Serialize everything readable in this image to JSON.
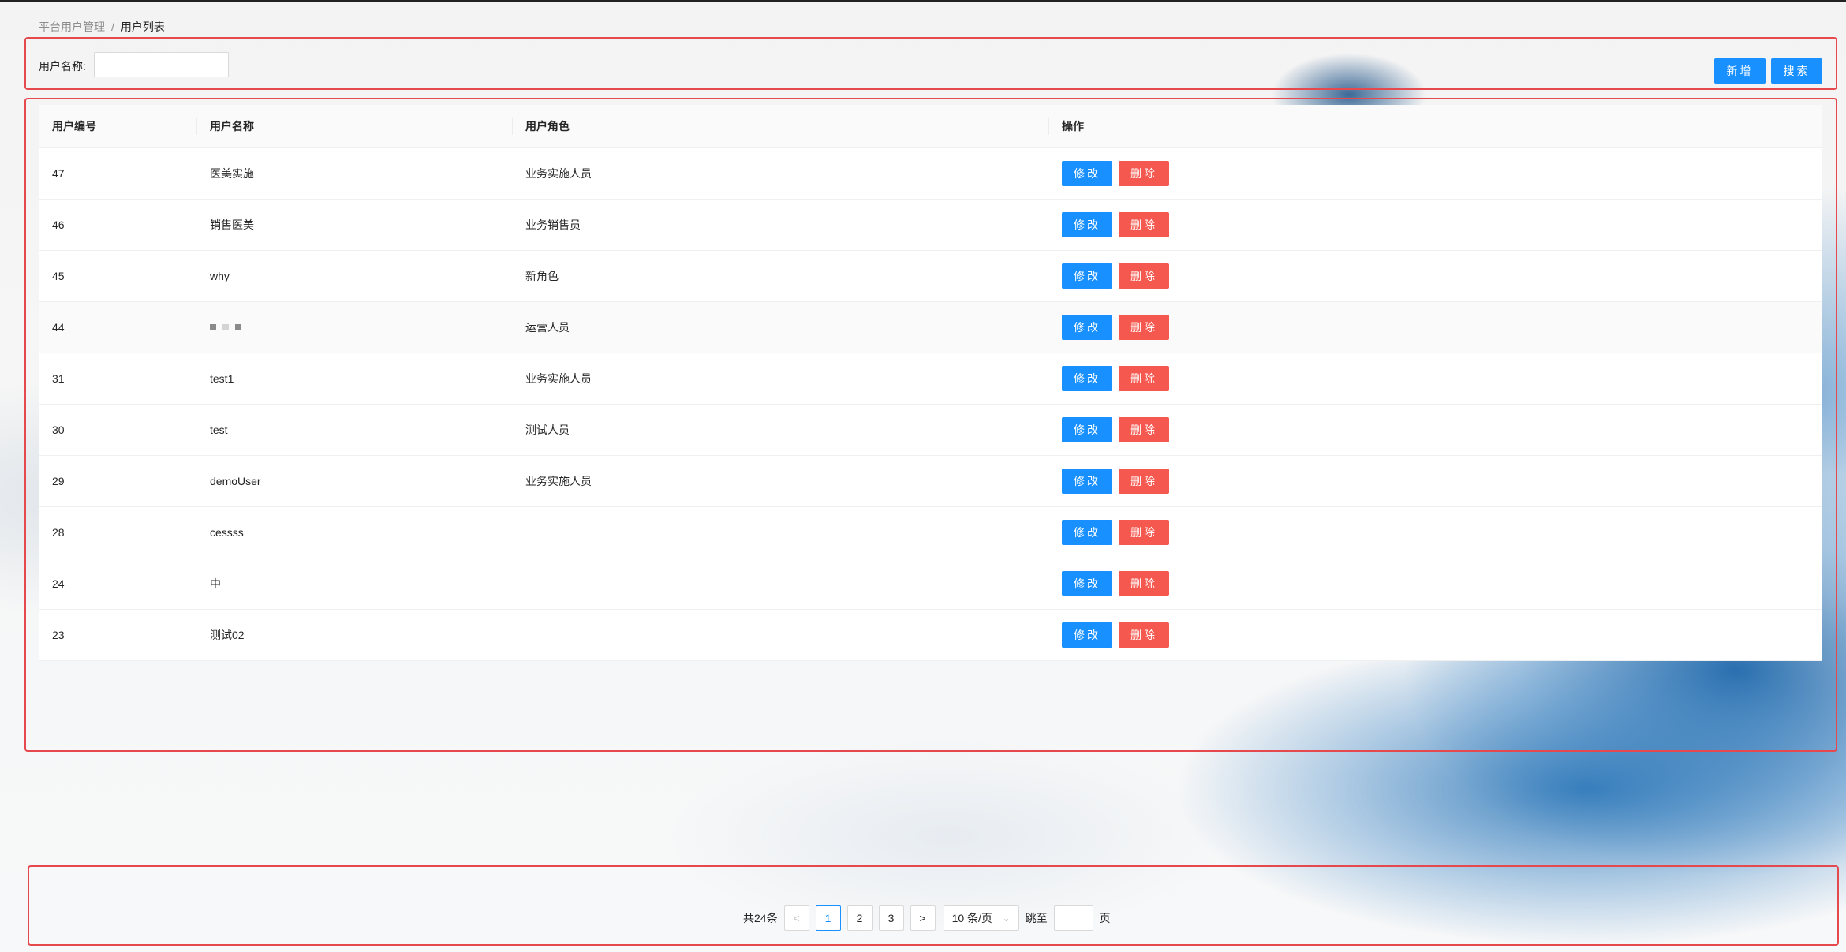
{
  "breadcrumb": {
    "parent": "平台用户管理",
    "separator": "/",
    "current": "用户列表"
  },
  "search": {
    "label": "用户名称:",
    "value": "",
    "placeholder": "",
    "add_label": "新增",
    "search_label": "搜索"
  },
  "table": {
    "headers": [
      "用户编号",
      "用户名称",
      "用户角色",
      "操作"
    ],
    "edit_label": "修改",
    "delete_label": "删除",
    "rows": [
      {
        "id": "47",
        "name": "医美实施",
        "role": "业务实施人员"
      },
      {
        "id": "46",
        "name": "销售医美",
        "role": "业务销售员"
      },
      {
        "id": "45",
        "name": "why",
        "role": "新角色"
      },
      {
        "id": "44",
        "name": "",
        "role": "运营人员"
      },
      {
        "id": "31",
        "name": "test1",
        "role": "业务实施人员"
      },
      {
        "id": "30",
        "name": "test",
        "role": "测试人员"
      },
      {
        "id": "29",
        "name": "demoUser",
        "role": "业务实施人员"
      },
      {
        "id": "28",
        "name": "cessss",
        "role": ""
      },
      {
        "id": "24",
        "name": "中",
        "role": ""
      },
      {
        "id": "23",
        "name": "测试02",
        "role": ""
      }
    ]
  },
  "pagination": {
    "total": "共24条",
    "prev": "<",
    "next": ">",
    "pages": [
      "1",
      "2",
      "3"
    ],
    "current_page": "1",
    "page_size": "10 条/页",
    "jump_label": "跳至",
    "jump_value": "",
    "page_suffix": "页"
  },
  "colors": {
    "primary": "#1890ff",
    "danger": "#f4584e",
    "highlight_box": "#e5484d"
  }
}
